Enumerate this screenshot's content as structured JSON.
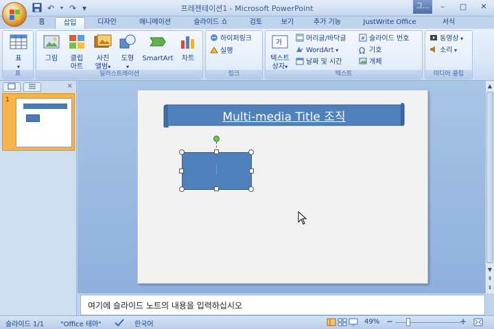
{
  "window": {
    "title": "프레젠테이션1 - Microsoft PowerPoint",
    "contextual_tab": "그...",
    "min_glyph": "–",
    "max_glyph": "□",
    "close_glyph": "✕"
  },
  "quick_access": {
    "save_icon": "save-icon",
    "undo_glyph": "↶",
    "redo_glyph": "↷",
    "customize_glyph": "▾"
  },
  "ribbon_tabs": [
    {
      "label": "홈"
    },
    {
      "label": "삽입",
      "selected": true
    },
    {
      "label": "디자인"
    },
    {
      "label": "애니메이션"
    },
    {
      "label": "슬라이드 쇼"
    },
    {
      "label": "검토"
    },
    {
      "label": "보기"
    },
    {
      "label": "추가 기능"
    },
    {
      "label": "JustWrite Office"
    },
    {
      "label": "서식"
    }
  ],
  "groups": {
    "table": {
      "label": "표",
      "btn": "표"
    },
    "illustrations": {
      "label": "일러스트레이션",
      "picture": "그림",
      "clipart_1": "클립",
      "clipart_2": "아트",
      "photo_1": "사진",
      "photo_2": "앨범",
      "shapes": "도형",
      "smartart": "SmartArt",
      "chart": "차트"
    },
    "links": {
      "label": "링크",
      "hyperlink": "하이퍼링크",
      "action": "실행"
    },
    "text": {
      "label": "텍스트",
      "textbox_1": "텍스트",
      "textbox_2": "상자",
      "header_footer": "머리글/바닥글",
      "wordart": "WordArt",
      "date_time": "날짜 및 시간",
      "slide_number": "슬라이드 번호",
      "symbol": "기호",
      "object": "개체"
    },
    "media": {
      "label": "미디어 클립",
      "movie": "동영상",
      "sound": "소리"
    }
  },
  "left_pane": {
    "slide_number": "1",
    "close_glyph": "×"
  },
  "slide": {
    "title": "Multi-media Title 조직"
  },
  "notes": {
    "placeholder": "여기에 슬라이드 노트의 내용을 입력하십시오"
  },
  "status": {
    "slide_info": "슬라이드 1/1",
    "theme": "\"Office 테마\"",
    "language": "한국어",
    "zoom": "49%",
    "zoom_out": "−",
    "zoom_in": "+"
  },
  "colors": {
    "accent": "#4f81bd",
    "selected_thumb": "#f7b44c"
  }
}
